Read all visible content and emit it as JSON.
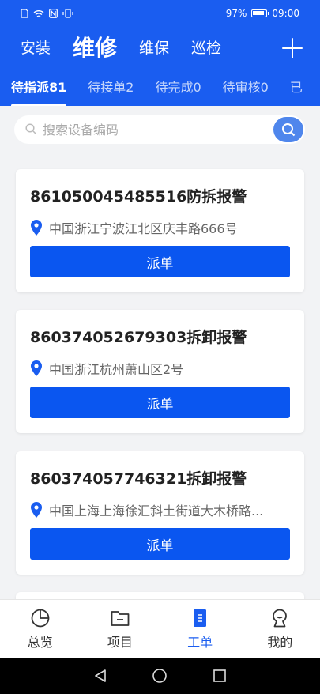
{
  "status_bar": {
    "battery": "97%",
    "time": "09:00"
  },
  "top_nav": {
    "items": [
      "安装",
      "维修",
      "维保",
      "巡检"
    ],
    "active_index": 1
  },
  "sub_tabs": [
    "待指派81",
    "待接单2",
    "待完成0",
    "待审核0",
    "已"
  ],
  "search": {
    "placeholder": "搜索设备编码"
  },
  "cards": [
    {
      "title": "861050045485516防拆报警",
      "address": "中国浙江宁波江北区庆丰路666号",
      "button": "派单"
    },
    {
      "title": "860374052679303拆卸报警",
      "address": "中国浙江杭州萧山区2号",
      "button": "派单"
    },
    {
      "title": "860374057746321拆卸报警",
      "address": "中国上海上海徐汇斜土街道大木桥路...",
      "button": "派单"
    }
  ],
  "bottom_nav": [
    {
      "label": "总览",
      "icon": "pie-chart-icon"
    },
    {
      "label": "项目",
      "icon": "folder-icon"
    },
    {
      "label": "工单",
      "icon": "work-order-icon"
    },
    {
      "label": "我的",
      "icon": "profile-icon"
    }
  ],
  "colors": {
    "brand": "#1a5df0",
    "button": "#0a56f0"
  }
}
